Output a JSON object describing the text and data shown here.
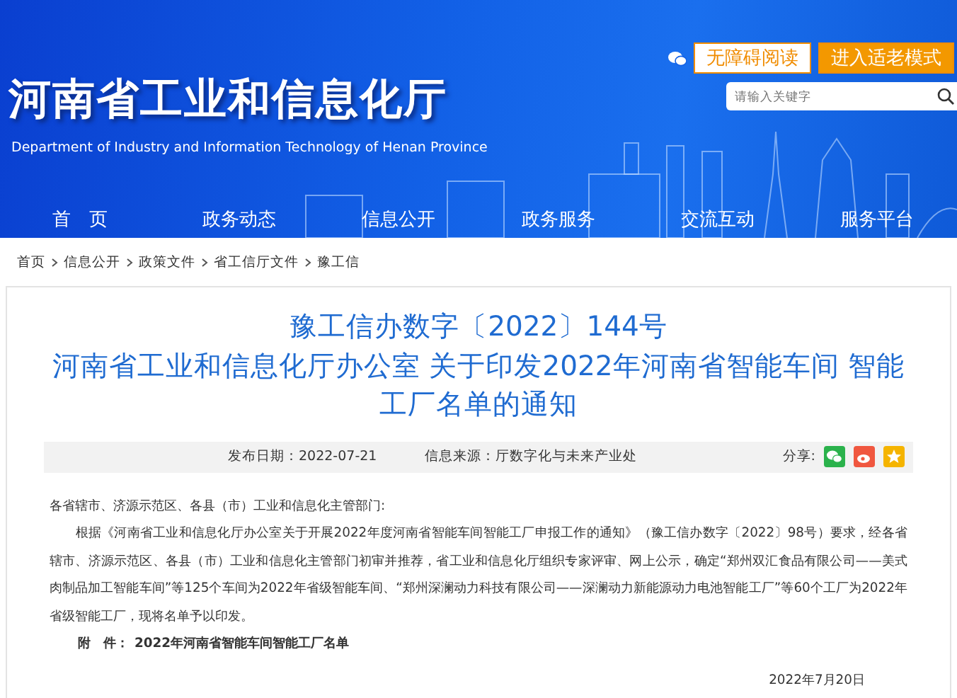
{
  "header": {
    "title": "河南省工业和信息化厅",
    "subtitle": "Department of Industry and Information Technology of Henan Province",
    "buttons": [
      {
        "label": "无障碍阅读",
        "kind": "outline"
      },
      {
        "label": "进入适老模式",
        "kind": "filled"
      }
    ],
    "search": {
      "placeholder": "请输入关键字"
    },
    "nav": [
      "首　页",
      "政务动态",
      "信息公开",
      "政务服务",
      "交流互动",
      "服务平台"
    ]
  },
  "breadcrumb": [
    "首页",
    "信息公开",
    "政策文件",
    "省工信厅文件",
    "豫工信"
  ],
  "article": {
    "title_lines": [
      "豫工信办数字〔2022〕144号",
      "河南省工业和信息化厅办公室 关于印发2022年河南省智能车间 智能工厂名单的通知"
    ],
    "published": "发布日期：2022-07-21",
    "source": "信息来源：厅数字化与未来产业处",
    "share_label": "分享:",
    "salutation": "各省辖市、济源示范区、各县（市）工业和信息化主管部门:",
    "body": "根据《河南省工业和信息化厅办公室关于开展2022年度河南省智能车间智能工厂申报工作的通知》（豫工信办数字〔2022〕98号）要求，经各省辖市、济源示范区、各县（市）工业和信息化主管部门初审并推荐，省工业和信息化厅组织专家评审、网上公示，确定“郑州双汇食品有限公司——美式肉制品加工智能车间”等125个车间为2022年省级智能车间、“郑州深澜动力科技有限公司——深澜动力新能源动力电池智能工厂”等60个工厂为2022年省级智能工厂，现将名单予以印发。",
    "attachment_label": "附　件：",
    "attachment": "2022年河南省智能车间智能工厂名单",
    "date": "2022年7月20日"
  }
}
